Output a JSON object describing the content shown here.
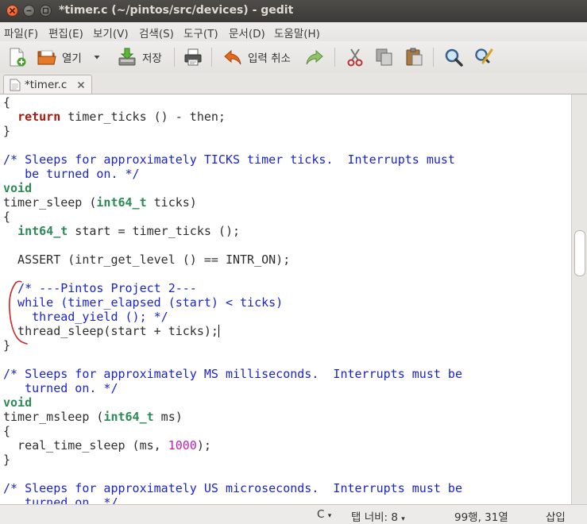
{
  "window": {
    "title": "*timer.c (~/pintos/src/devices) - gedit"
  },
  "menu": [
    "파일(F)",
    "편집(E)",
    "보기(V)",
    "검색(S)",
    "도구(T)",
    "문서(D)",
    "도움말(H)"
  ],
  "toolbar": {
    "open_label": "열기",
    "save_label": "저장",
    "undo_label": "입력 취소"
  },
  "tab": {
    "label": "*timer.c"
  },
  "editor": {
    "lines": [
      "{",
      "  return timer_ticks () - then;",
      "}",
      "",
      "/* Sleeps for approximately TICKS timer ticks.  Interrupts must",
      "   be turned on. */",
      "void",
      "timer_sleep (int64_t ticks)",
      "{",
      "  int64_t start = timer_ticks ();",
      "",
      "  ASSERT (intr_get_level () == INTR_ON);",
      "",
      "  /* ---Pintos Project 2---",
      "  while (timer_elapsed (start) < ticks)",
      "    thread_yield (); */",
      "  thread_sleep(start + ticks);",
      "}",
      "",
      "/* Sleeps for approximately MS milliseconds.  Interrupts must be",
      "   turned on. */",
      "void",
      "timer_msleep (int64_t ms)",
      "{",
      "  real_time_sleep (ms, 1000);",
      "}",
      "",
      "/* Sleeps for approximately US microseconds.  Interrupts must be",
      "   turned on. */"
    ]
  },
  "status": {
    "language": "C",
    "tab_width": "탭 너비: 8",
    "position": "99행, 31열",
    "mode": "삽입"
  },
  "colors": {
    "comment": "#1a23d3",
    "keyword": "#a3190f",
    "type": "#2c8a55",
    "number": "#c01bbd",
    "annotation": "#d42020"
  }
}
